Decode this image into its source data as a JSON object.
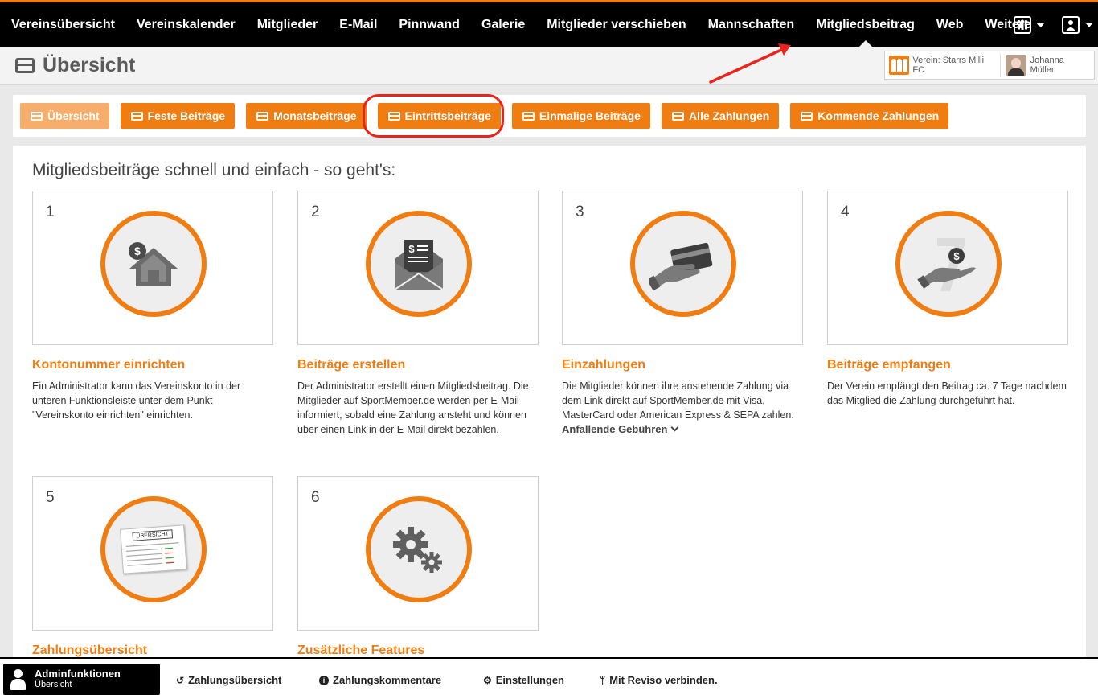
{
  "nav": {
    "items": [
      {
        "label": "Vereinsübersicht"
      },
      {
        "label": "Vereinskalender"
      },
      {
        "label": "Mitglieder"
      },
      {
        "label": "E-Mail"
      },
      {
        "label": "Pinnwand"
      },
      {
        "label": "Galerie"
      },
      {
        "label": "Mitglieder verschieben"
      },
      {
        "label": "Mannschaften"
      },
      {
        "label": "Mitgliedsbeitrag"
      },
      {
        "label": "Web"
      },
      {
        "label": "Weitere"
      }
    ],
    "active_index": 8,
    "accent": "#f07d12"
  },
  "header": {
    "title": "Übersicht",
    "club_label": "Verein: Starrs Milli FC",
    "user_name": "Johanna Müller"
  },
  "tabs": [
    {
      "label": "Übersicht"
    },
    {
      "label": "Feste Beiträge"
    },
    {
      "label": "Monatsbeiträge"
    },
    {
      "label": "Eintrittsbeiträge"
    },
    {
      "label": "Einmalige Beiträge"
    },
    {
      "label": "Alle Zahlungen"
    },
    {
      "label": "Kommende Zahlungen"
    }
  ],
  "main": {
    "heading": "Mitgliedsbeiträge schnell und einfach - so geht's:",
    "steps": [
      {
        "num": "1",
        "icon": "dollar-house-icon",
        "title": "Kontonummer einrichten",
        "desc": "Ein Administrator kann das Vereinskonto in der unteren Funktionsleiste unter dem Punkt \"Vereinskonto einrichten\" einrichten."
      },
      {
        "num": "2",
        "icon": "invoice-envelope-icon",
        "title": "Beiträge erstellen",
        "desc": "Der Administrator erstellt einen Mitgliedsbeitrag. Die Mitglieder auf SportMember.de werden per E-Mail informiert, sobald eine Zahlung ansteht und können über einen Link in der E-Mail direkt bezahlen."
      },
      {
        "num": "3",
        "icon": "hand-card-icon",
        "title": "Einzahlungen",
        "desc": "Die Mitglieder können ihre anstehende Zahlung via dem Link direkt auf SportMember.de mit Visa, MasterCard oder American Express & SEPA zahlen.",
        "link": "Anfallende Gebühren"
      },
      {
        "num": "4",
        "icon": "hand-coin-seven-icon",
        "title": "Beiträge empfangen",
        "desc": "Der Verein empfängt den Beitrag ca. 7 Tage nachdem das Mitglied die Zahlung durchgeführt hat."
      },
      {
        "num": "5",
        "icon": "overview-sheet-icon",
        "title": "Zahlungsübersicht",
        "sheet_label": "ÜBERSICHT"
      },
      {
        "num": "6",
        "icon": "gears-icon",
        "title": "Zusätzliche Features"
      }
    ]
  },
  "footer": {
    "admin_title": "Adminfunktionen",
    "admin_sub": "Übersicht",
    "links": [
      {
        "label": "Zahlungsübersicht",
        "icon": "history-icon"
      },
      {
        "label": "Zahlungskommentare",
        "icon": "info-icon"
      },
      {
        "label": "Einstellungen",
        "icon": "gear-icon"
      },
      {
        "label": "Mit Reviso verbinden.",
        "icon": "branch-icon"
      }
    ]
  }
}
